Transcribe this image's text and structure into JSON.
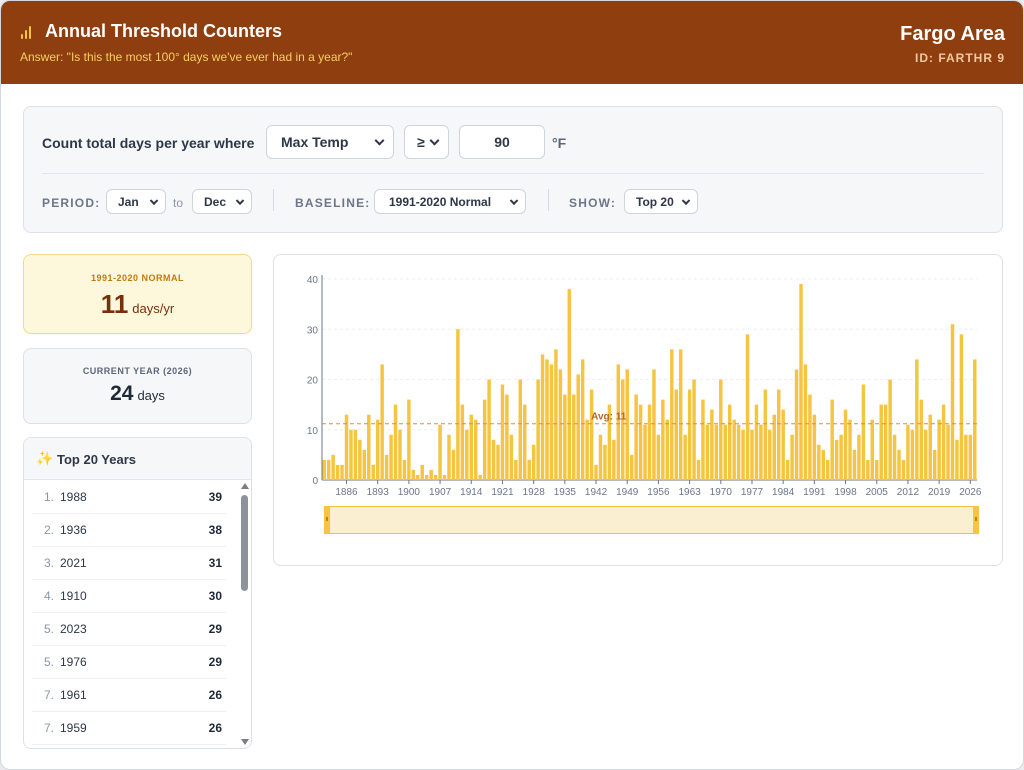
{
  "header": {
    "title": "Annual Threshold Counters",
    "subtitle": "Answer: \"Is this the most 100° days we've ever had in a year?\"",
    "area": "Fargo Area",
    "station_id": "ID: FARTHR 9",
    "icon": "bar-chart-icon"
  },
  "controls": {
    "count_label": "Count total days per year where",
    "variable": "Max Temp",
    "operator": "≥",
    "threshold": "90",
    "unit": "°F",
    "period_label": "PERIOD:",
    "period_from": "Jan",
    "period_to_label": "to",
    "period_to": "Dec",
    "baseline_label": "BASELINE:",
    "baseline": "1991-2020 Normal",
    "show_label": "SHOW:",
    "show": "Top 20"
  },
  "normal_card": {
    "label": "1991-2020 NORMAL",
    "value": "11",
    "unit": "days/yr"
  },
  "current_card": {
    "label": "CURRENT YEAR (2026)",
    "value": "24",
    "unit": "days"
  },
  "top_years": {
    "title": "Top 20 Years",
    "icon": "sparkles-icon",
    "rows": [
      {
        "rank": "1.",
        "year": "1988",
        "count": "39"
      },
      {
        "rank": "2.",
        "year": "1936",
        "count": "38"
      },
      {
        "rank": "3.",
        "year": "2021",
        "count": "31"
      },
      {
        "rank": "4.",
        "year": "1910",
        "count": "30"
      },
      {
        "rank": "5.",
        "year": "2023",
        "count": "29"
      },
      {
        "rank": "5.",
        "year": "1976",
        "count": "29"
      },
      {
        "rank": "7.",
        "year": "1961",
        "count": "26"
      },
      {
        "rank": "7.",
        "year": "1959",
        "count": "26"
      }
    ]
  },
  "chart_data": {
    "type": "bar",
    "title": "",
    "xlabel": "",
    "ylabel": "",
    "ylim": [
      0,
      40
    ],
    "yticks": [
      0,
      10,
      20,
      30,
      40
    ],
    "xticks": [
      "1886",
      "1893",
      "1900",
      "1907",
      "1914",
      "1921",
      "1928",
      "1935",
      "1942",
      "1949",
      "1956",
      "1963",
      "1970",
      "1977",
      "1984",
      "1991",
      "1998",
      "2005",
      "2012",
      "2019",
      "2026"
    ],
    "x_start": 1881,
    "x_end": 2026,
    "grid": true,
    "bar_color": "#f5c542",
    "avg_label": "Avg: 11",
    "avg_value": 11.2,
    "avg_color": "#e0894a",
    "values": [
      4,
      4,
      5,
      3,
      3,
      13,
      10,
      10,
      8,
      6,
      13,
      3,
      12,
      23,
      5,
      9,
      15,
      10,
      4,
      16,
      2,
      1,
      3,
      1,
      2,
      1,
      11,
      1,
      9,
      6,
      30,
      15,
      10,
      13,
      12,
      1,
      16,
      20,
      8,
      7,
      19,
      17,
      9,
      4,
      20,
      15,
      4,
      7,
      20,
      25,
      24,
      23,
      26,
      22,
      17,
      38,
      17,
      21,
      24,
      12,
      18,
      3,
      9,
      7,
      15,
      8,
      23,
      20,
      22,
      5,
      17,
      15,
      11,
      15,
      22,
      9,
      16,
      12,
      26,
      18,
      26,
      9,
      18,
      20,
      4,
      16,
      11,
      14,
      11,
      20,
      11,
      15,
      12,
      11,
      10,
      29,
      10,
      15,
      11,
      18,
      10,
      13,
      18,
      14,
      4,
      9,
      22,
      39,
      23,
      17,
      13,
      7,
      6,
      4,
      16,
      8,
      9,
      14,
      12,
      6,
      9,
      19,
      4,
      12,
      4,
      15,
      15,
      20,
      9,
      6,
      4,
      11,
      10,
      24,
      16,
      10,
      13,
      6,
      12,
      15,
      11,
      31,
      8,
      29,
      9,
      9,
      24
    ]
  }
}
